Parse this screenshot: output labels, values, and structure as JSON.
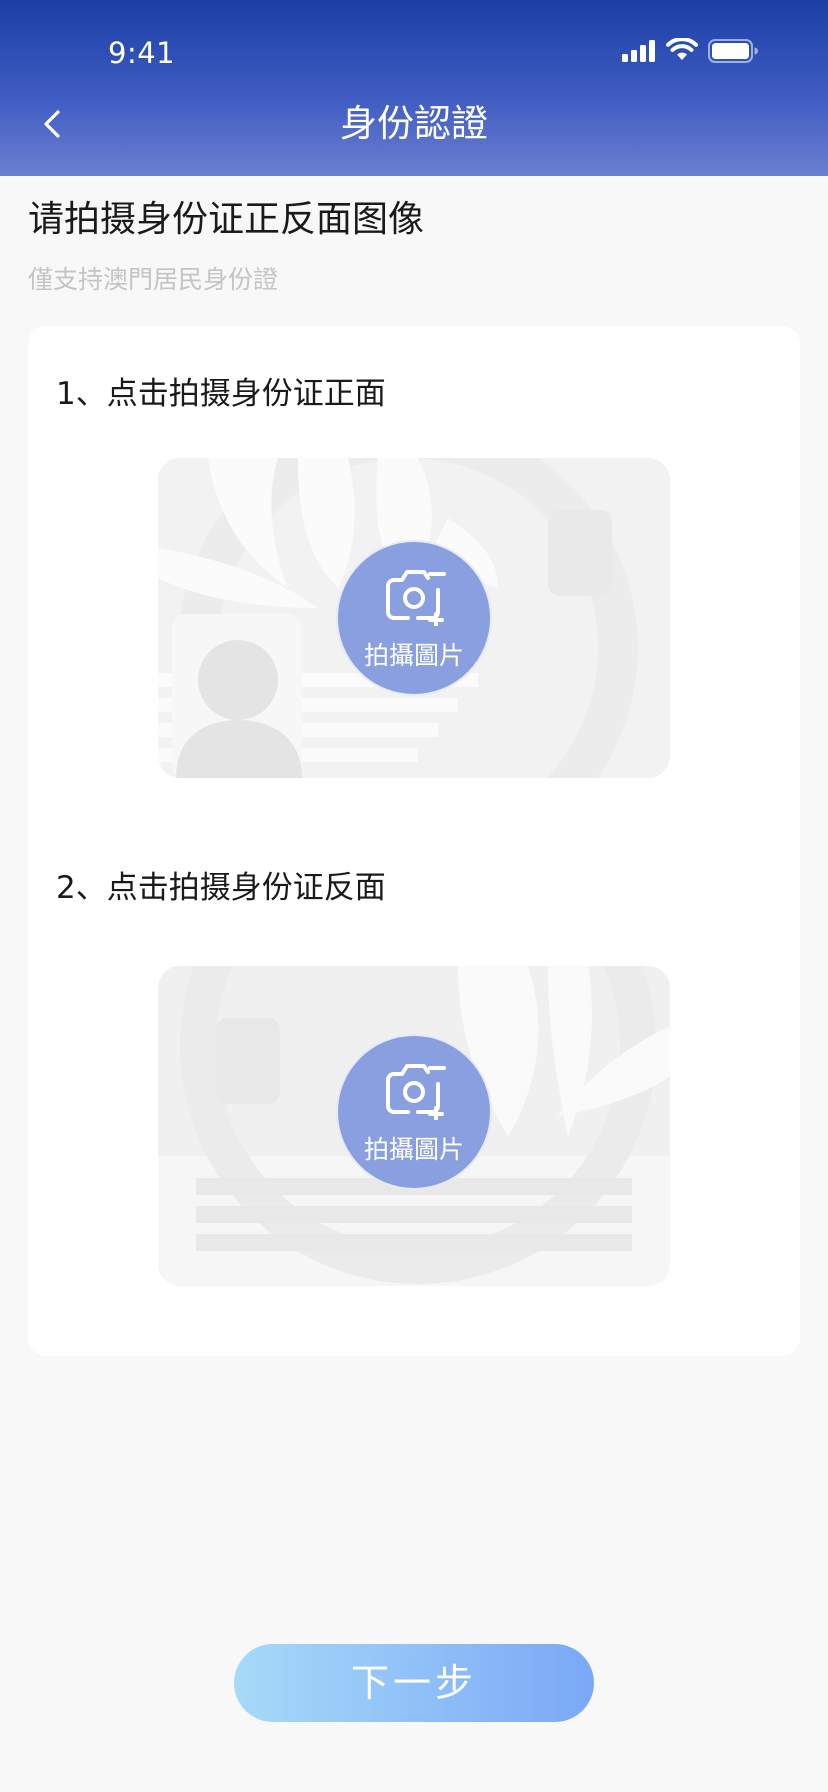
{
  "status_bar": {
    "time": "9:41"
  },
  "header": {
    "title": "身份認證",
    "back_icon": "chevron-left-icon"
  },
  "intro": {
    "heading": "请拍摄身份证正反面图像",
    "subheading": "僅支持澳門居民身份證"
  },
  "steps": [
    {
      "label": "1、点击拍摄身份证正面",
      "capture_label": "拍攝圖片",
      "icon": "camera-plus-icon"
    },
    {
      "label": "2、点击拍摄身份证反面",
      "capture_label": "拍攝圖片",
      "icon": "camera-plus-icon"
    }
  ],
  "next_button": {
    "label": "下一步"
  },
  "colors": {
    "header_top": "#1b3fa6",
    "header_bottom": "#6a7fd0",
    "capture_button": "#8a9fdf",
    "next_gradient_start": "#a6daf8",
    "next_gradient_end": "#7aa8f7"
  }
}
